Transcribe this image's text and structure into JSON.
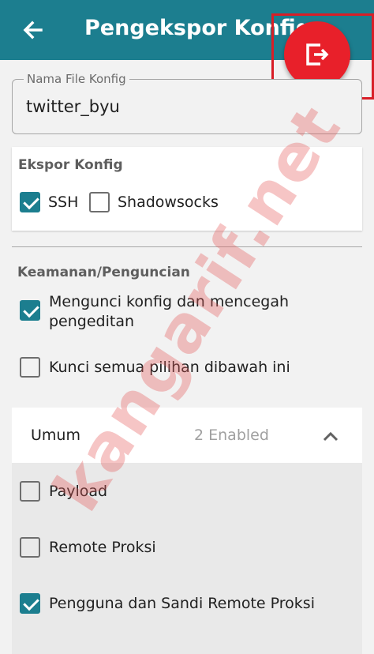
{
  "appbar": {
    "title": "Pengekspor Konfig",
    "color": "#1c7e8f"
  },
  "icons": {
    "back": "arrow-left-icon",
    "export": "export-icon",
    "collapse": "chevron-up-icon"
  },
  "fab": {
    "color": "#e8202a"
  },
  "filename": {
    "label": "Nama File Konfig",
    "value": "twitter_byu"
  },
  "export_section": {
    "title": "Ekspor Konfig",
    "options": [
      {
        "label": "SSH",
        "checked": true
      },
      {
        "label": "Shadowsocks",
        "checked": false
      }
    ]
  },
  "security": {
    "title": "Keamanan/Penguncian",
    "options": [
      {
        "label": "Mengunci konfig dan mencegah pengeditan",
        "checked": true
      },
      {
        "label": "Kunci semua pilihan dibawah ini",
        "checked": false
      }
    ]
  },
  "general": {
    "title": "Umum",
    "count": "2 Enabled",
    "options": [
      {
        "label": "Payload",
        "checked": false
      },
      {
        "label": "Remote Proksi",
        "checked": false
      },
      {
        "label": "Pengguna dan Sandi Remote Proksi",
        "checked": true
      }
    ]
  },
  "watermark": "kangarif.net"
}
